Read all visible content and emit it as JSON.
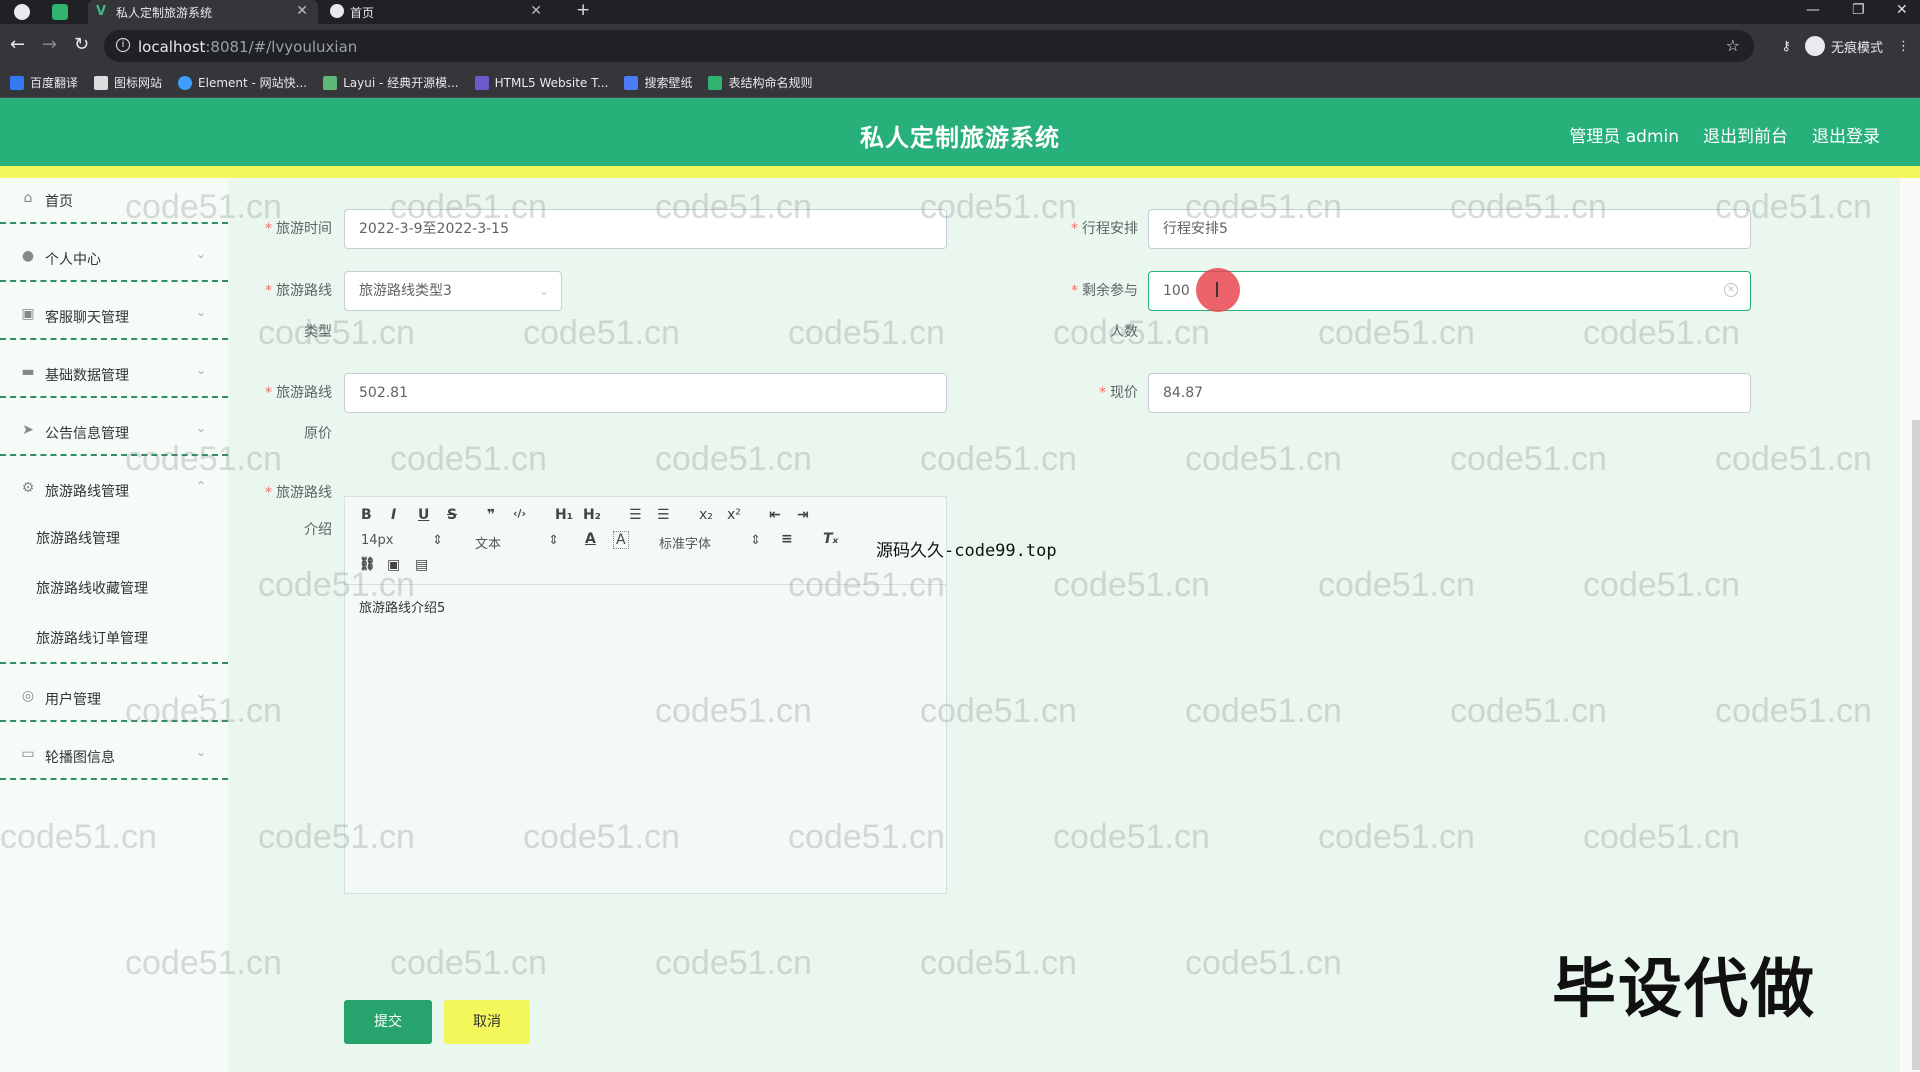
{
  "browser": {
    "tabs": [
      {
        "title": "私人定制旅游系统",
        "active": true
      },
      {
        "title": "首页",
        "active": false
      }
    ],
    "url_host": "localhost",
    "url_path": ":8081/#/lvyouluxian",
    "incognito_label": "无痕模式",
    "bookmarks": [
      {
        "label": "百度翻译",
        "color": "#3478f6"
      },
      {
        "label": "图标网站",
        "color": "#222222"
      },
      {
        "label": "Element - 网站快...",
        "color": "#409eff"
      },
      {
        "label": "Layui - 经典开源模...",
        "color": "#5fb878"
      },
      {
        "label": "HTML5 Website T...",
        "color": "#6a5acd"
      },
      {
        "label": "搜索壁纸",
        "color": "#4a7cf7"
      },
      {
        "label": "表结构命名规则",
        "color": "#2fb46f"
      }
    ]
  },
  "header": {
    "title": "私人定制旅游系统",
    "admin_label": "管理员 admin",
    "front_label": "退出到前台",
    "logout_label": "退出登录",
    "accent": "#27b07a",
    "yellow": "#f3f75a"
  },
  "sidebar": {
    "items": [
      {
        "label": "首页",
        "icon": "home-icon",
        "glyph": "⌂"
      },
      {
        "label": "个人中心",
        "icon": "user-icon",
        "glyph": "●"
      },
      {
        "label": "客服聊天管理",
        "icon": "chat-icon",
        "glyph": "▣"
      },
      {
        "label": "基础数据管理",
        "icon": "briefcase-icon",
        "glyph": "▬"
      },
      {
        "label": "公告信息管理",
        "icon": "send-icon",
        "glyph": "➤"
      },
      {
        "label": "旅游路线管理",
        "icon": "settings-icon",
        "glyph": "⚙"
      },
      {
        "label": "用户管理",
        "icon": "compass-icon",
        "glyph": "◎"
      },
      {
        "label": "轮播图信息",
        "icon": "message-icon",
        "glyph": "▭"
      }
    ],
    "subitems": [
      "旅游路线管理",
      "旅游路线收藏管理",
      "旅游路线订单管理"
    ]
  },
  "form": {
    "travel_time_label": "旅游时间",
    "travel_time_value": "2022-3-9至2022-3-15",
    "itinerary_label": "行程安排",
    "itinerary_value": "行程安排5",
    "route_type_label_1": "旅游路线",
    "route_type_label_2": "类型",
    "route_type_value": "旅游路线类型3",
    "remaining_label_1": "剩余参与",
    "remaining_label_2": "人数",
    "remaining_value": "100",
    "original_price_label_1": "旅游路线",
    "original_price_label_2": "原价",
    "original_price_value": "502.81",
    "current_price_label": "现价",
    "current_price_value": "84.87",
    "intro_label_1": "旅游路线",
    "intro_label_2": "介绍",
    "intro_content": "旅游路线介绍5",
    "submit_label": "提交",
    "cancel_label": "取消"
  },
  "editor_toolbar": {
    "bold": "B",
    "italic": "I",
    "underline": "U",
    "strike": "S",
    "quote": "❞",
    "code": "‹/›",
    "h1": "H₁",
    "h2": "H₂",
    "ol": "☰",
    "ul": "☰",
    "sub": "x₂",
    "sup": "x²",
    "outdent": "⇤",
    "indent": "⇥",
    "font_size": "14px",
    "format": "文本",
    "font_color": "A",
    "font_bg": "A",
    "font_family": "标准字体",
    "align": "≡",
    "clear": "Tₓ",
    "link": "🔗",
    "image": "▣",
    "video": "▤"
  },
  "overlay": {
    "source_note": "源码久久-code99.top",
    "big_note": "毕设代做",
    "watermark": "code51.cn"
  }
}
